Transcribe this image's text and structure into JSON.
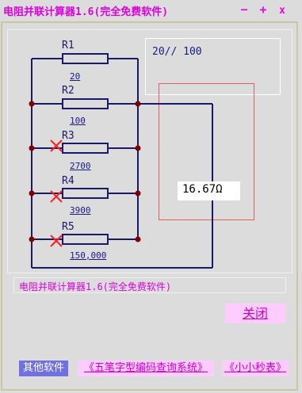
{
  "window": {
    "title": "电阻并联计算器1.6(完全免费软件)",
    "buttons": {
      "minimize": "−",
      "maximize": "+",
      "close": "x"
    }
  },
  "expression": "20// 100",
  "result": "16.67Ω",
  "resistors": [
    {
      "name": "R1",
      "value": "20",
      "disabled": false
    },
    {
      "name": "R2",
      "value": "100",
      "disabled": false
    },
    {
      "name": "R3",
      "value": "2700",
      "disabled": true
    },
    {
      "name": "R4",
      "value": "3900",
      "disabled": true
    },
    {
      "name": "R5",
      "value": "150,000",
      "disabled": true
    }
  ],
  "status_text": "电阻并联计算器1.6(完全免费软件)",
  "close_button": "关闭",
  "footer": {
    "label": "其他软件",
    "links": [
      "《五笔字型编码查询系统》",
      "《小小秒表》"
    ]
  },
  "colors": {
    "accent": "#dd00dd",
    "wire": "#1a1a6a",
    "node": "#800000",
    "disabled_mark": "#ff2020"
  }
}
